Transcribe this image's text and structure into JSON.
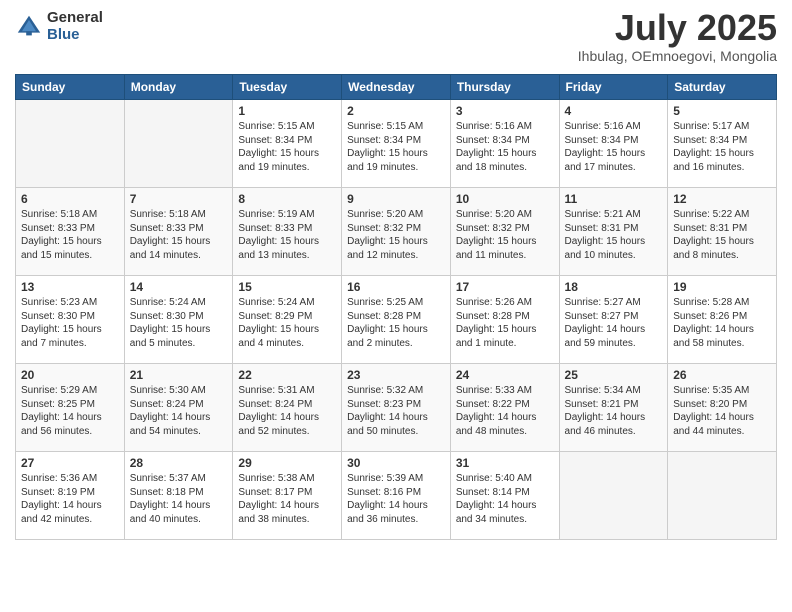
{
  "logo": {
    "general": "General",
    "blue": "Blue"
  },
  "title": "July 2025",
  "subtitle": "Ihbulag, OEmnoegovi, Mongolia",
  "days_of_week": [
    "Sunday",
    "Monday",
    "Tuesday",
    "Wednesday",
    "Thursday",
    "Friday",
    "Saturday"
  ],
  "weeks": [
    [
      {
        "day": "",
        "info": ""
      },
      {
        "day": "",
        "info": ""
      },
      {
        "day": "1",
        "info": "Sunrise: 5:15 AM\nSunset: 8:34 PM\nDaylight: 15 hours and 19 minutes."
      },
      {
        "day": "2",
        "info": "Sunrise: 5:15 AM\nSunset: 8:34 PM\nDaylight: 15 hours and 19 minutes."
      },
      {
        "day": "3",
        "info": "Sunrise: 5:16 AM\nSunset: 8:34 PM\nDaylight: 15 hours and 18 minutes."
      },
      {
        "day": "4",
        "info": "Sunrise: 5:16 AM\nSunset: 8:34 PM\nDaylight: 15 hours and 17 minutes."
      },
      {
        "day": "5",
        "info": "Sunrise: 5:17 AM\nSunset: 8:34 PM\nDaylight: 15 hours and 16 minutes."
      }
    ],
    [
      {
        "day": "6",
        "info": "Sunrise: 5:18 AM\nSunset: 8:33 PM\nDaylight: 15 hours and 15 minutes."
      },
      {
        "day": "7",
        "info": "Sunrise: 5:18 AM\nSunset: 8:33 PM\nDaylight: 15 hours and 14 minutes."
      },
      {
        "day": "8",
        "info": "Sunrise: 5:19 AM\nSunset: 8:33 PM\nDaylight: 15 hours and 13 minutes."
      },
      {
        "day": "9",
        "info": "Sunrise: 5:20 AM\nSunset: 8:32 PM\nDaylight: 15 hours and 12 minutes."
      },
      {
        "day": "10",
        "info": "Sunrise: 5:20 AM\nSunset: 8:32 PM\nDaylight: 15 hours and 11 minutes."
      },
      {
        "day": "11",
        "info": "Sunrise: 5:21 AM\nSunset: 8:31 PM\nDaylight: 15 hours and 10 minutes."
      },
      {
        "day": "12",
        "info": "Sunrise: 5:22 AM\nSunset: 8:31 PM\nDaylight: 15 hours and 8 minutes."
      }
    ],
    [
      {
        "day": "13",
        "info": "Sunrise: 5:23 AM\nSunset: 8:30 PM\nDaylight: 15 hours and 7 minutes."
      },
      {
        "day": "14",
        "info": "Sunrise: 5:24 AM\nSunset: 8:30 PM\nDaylight: 15 hours and 5 minutes."
      },
      {
        "day": "15",
        "info": "Sunrise: 5:24 AM\nSunset: 8:29 PM\nDaylight: 15 hours and 4 minutes."
      },
      {
        "day": "16",
        "info": "Sunrise: 5:25 AM\nSunset: 8:28 PM\nDaylight: 15 hours and 2 minutes."
      },
      {
        "day": "17",
        "info": "Sunrise: 5:26 AM\nSunset: 8:28 PM\nDaylight: 15 hours and 1 minute."
      },
      {
        "day": "18",
        "info": "Sunrise: 5:27 AM\nSunset: 8:27 PM\nDaylight: 14 hours and 59 minutes."
      },
      {
        "day": "19",
        "info": "Sunrise: 5:28 AM\nSunset: 8:26 PM\nDaylight: 14 hours and 58 minutes."
      }
    ],
    [
      {
        "day": "20",
        "info": "Sunrise: 5:29 AM\nSunset: 8:25 PM\nDaylight: 14 hours and 56 minutes."
      },
      {
        "day": "21",
        "info": "Sunrise: 5:30 AM\nSunset: 8:24 PM\nDaylight: 14 hours and 54 minutes."
      },
      {
        "day": "22",
        "info": "Sunrise: 5:31 AM\nSunset: 8:24 PM\nDaylight: 14 hours and 52 minutes."
      },
      {
        "day": "23",
        "info": "Sunrise: 5:32 AM\nSunset: 8:23 PM\nDaylight: 14 hours and 50 minutes."
      },
      {
        "day": "24",
        "info": "Sunrise: 5:33 AM\nSunset: 8:22 PM\nDaylight: 14 hours and 48 minutes."
      },
      {
        "day": "25",
        "info": "Sunrise: 5:34 AM\nSunset: 8:21 PM\nDaylight: 14 hours and 46 minutes."
      },
      {
        "day": "26",
        "info": "Sunrise: 5:35 AM\nSunset: 8:20 PM\nDaylight: 14 hours and 44 minutes."
      }
    ],
    [
      {
        "day": "27",
        "info": "Sunrise: 5:36 AM\nSunset: 8:19 PM\nDaylight: 14 hours and 42 minutes."
      },
      {
        "day": "28",
        "info": "Sunrise: 5:37 AM\nSunset: 8:18 PM\nDaylight: 14 hours and 40 minutes."
      },
      {
        "day": "29",
        "info": "Sunrise: 5:38 AM\nSunset: 8:17 PM\nDaylight: 14 hours and 38 minutes."
      },
      {
        "day": "30",
        "info": "Sunrise: 5:39 AM\nSunset: 8:16 PM\nDaylight: 14 hours and 36 minutes."
      },
      {
        "day": "31",
        "info": "Sunrise: 5:40 AM\nSunset: 8:14 PM\nDaylight: 14 hours and 34 minutes."
      },
      {
        "day": "",
        "info": ""
      },
      {
        "day": "",
        "info": ""
      }
    ]
  ]
}
